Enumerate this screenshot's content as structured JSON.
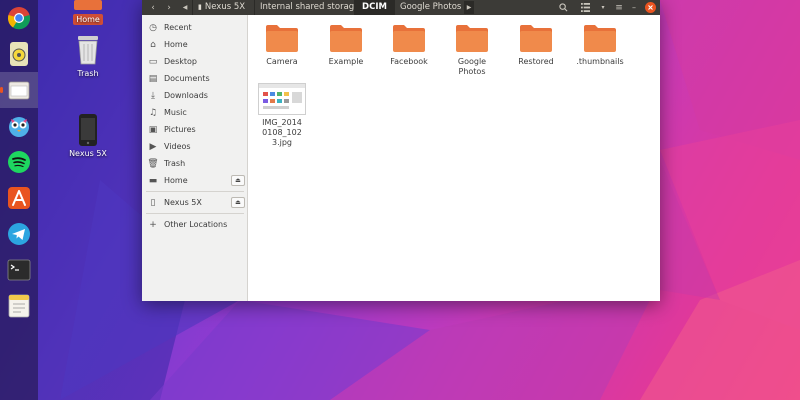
{
  "colors": {
    "accent": "#e95420",
    "folder": "#f08a4b",
    "folder_tab": "#e8713a",
    "headerbar": "#3c3b37",
    "sidebar": "#f1f1f0"
  },
  "desktop": {
    "icons": [
      {
        "label": "Home",
        "icon": "home-folder-icon",
        "selected": true
      },
      {
        "label": "Trash",
        "icon": "trash-icon"
      },
      {
        "label": "Nexus 5X",
        "icon": "phone-icon"
      }
    ]
  },
  "dock": {
    "items": [
      {
        "name": "chrome-icon"
      },
      {
        "name": "rhythmbox-icon"
      },
      {
        "name": "files-icon"
      },
      {
        "name": "owl-app-icon"
      },
      {
        "name": "spotify-icon"
      },
      {
        "name": "software-center-icon"
      },
      {
        "name": "telegram-icon"
      },
      {
        "name": "terminal-icon"
      },
      {
        "name": "notes-icon"
      }
    ]
  },
  "headerbar": {
    "back_icon": "chevron-left-icon",
    "forward_icon": "chevron-right-icon",
    "breadcrumbs": [
      {
        "label": "Nexus 5X"
      },
      {
        "label": "Internal shared storage"
      },
      {
        "label": "DCIM",
        "current": true
      },
      {
        "label": "Google Photos"
      }
    ]
  },
  "sidebar": {
    "items": [
      {
        "label": "Recent",
        "icon": "clock-icon"
      },
      {
        "label": "Home",
        "icon": "home-icon"
      },
      {
        "label": "Desktop",
        "icon": "folder-icon"
      },
      {
        "label": "Documents",
        "icon": "document-icon"
      },
      {
        "label": "Downloads",
        "icon": "download-icon"
      },
      {
        "label": "Music",
        "icon": "music-icon"
      },
      {
        "label": "Pictures",
        "icon": "picture-icon"
      },
      {
        "label": "Videos",
        "icon": "video-icon"
      },
      {
        "label": "Trash",
        "icon": "trash-icon"
      },
      {
        "label": "Home",
        "icon": "drive-icon",
        "eject": true
      },
      {
        "label": "Nexus 5X",
        "icon": "phone-icon",
        "eject": true
      },
      {
        "label": "Other Locations",
        "icon": "plus-icon"
      }
    ]
  },
  "content": {
    "folders": [
      {
        "label": "Camera"
      },
      {
        "label": "Example"
      },
      {
        "label": "Facebook"
      },
      {
        "label": "Google Photos"
      },
      {
        "label": "Restored"
      },
      {
        "label": ".thumbnails"
      }
    ],
    "files": [
      {
        "label": "IMG_20140108_1023.jpg"
      }
    ]
  }
}
